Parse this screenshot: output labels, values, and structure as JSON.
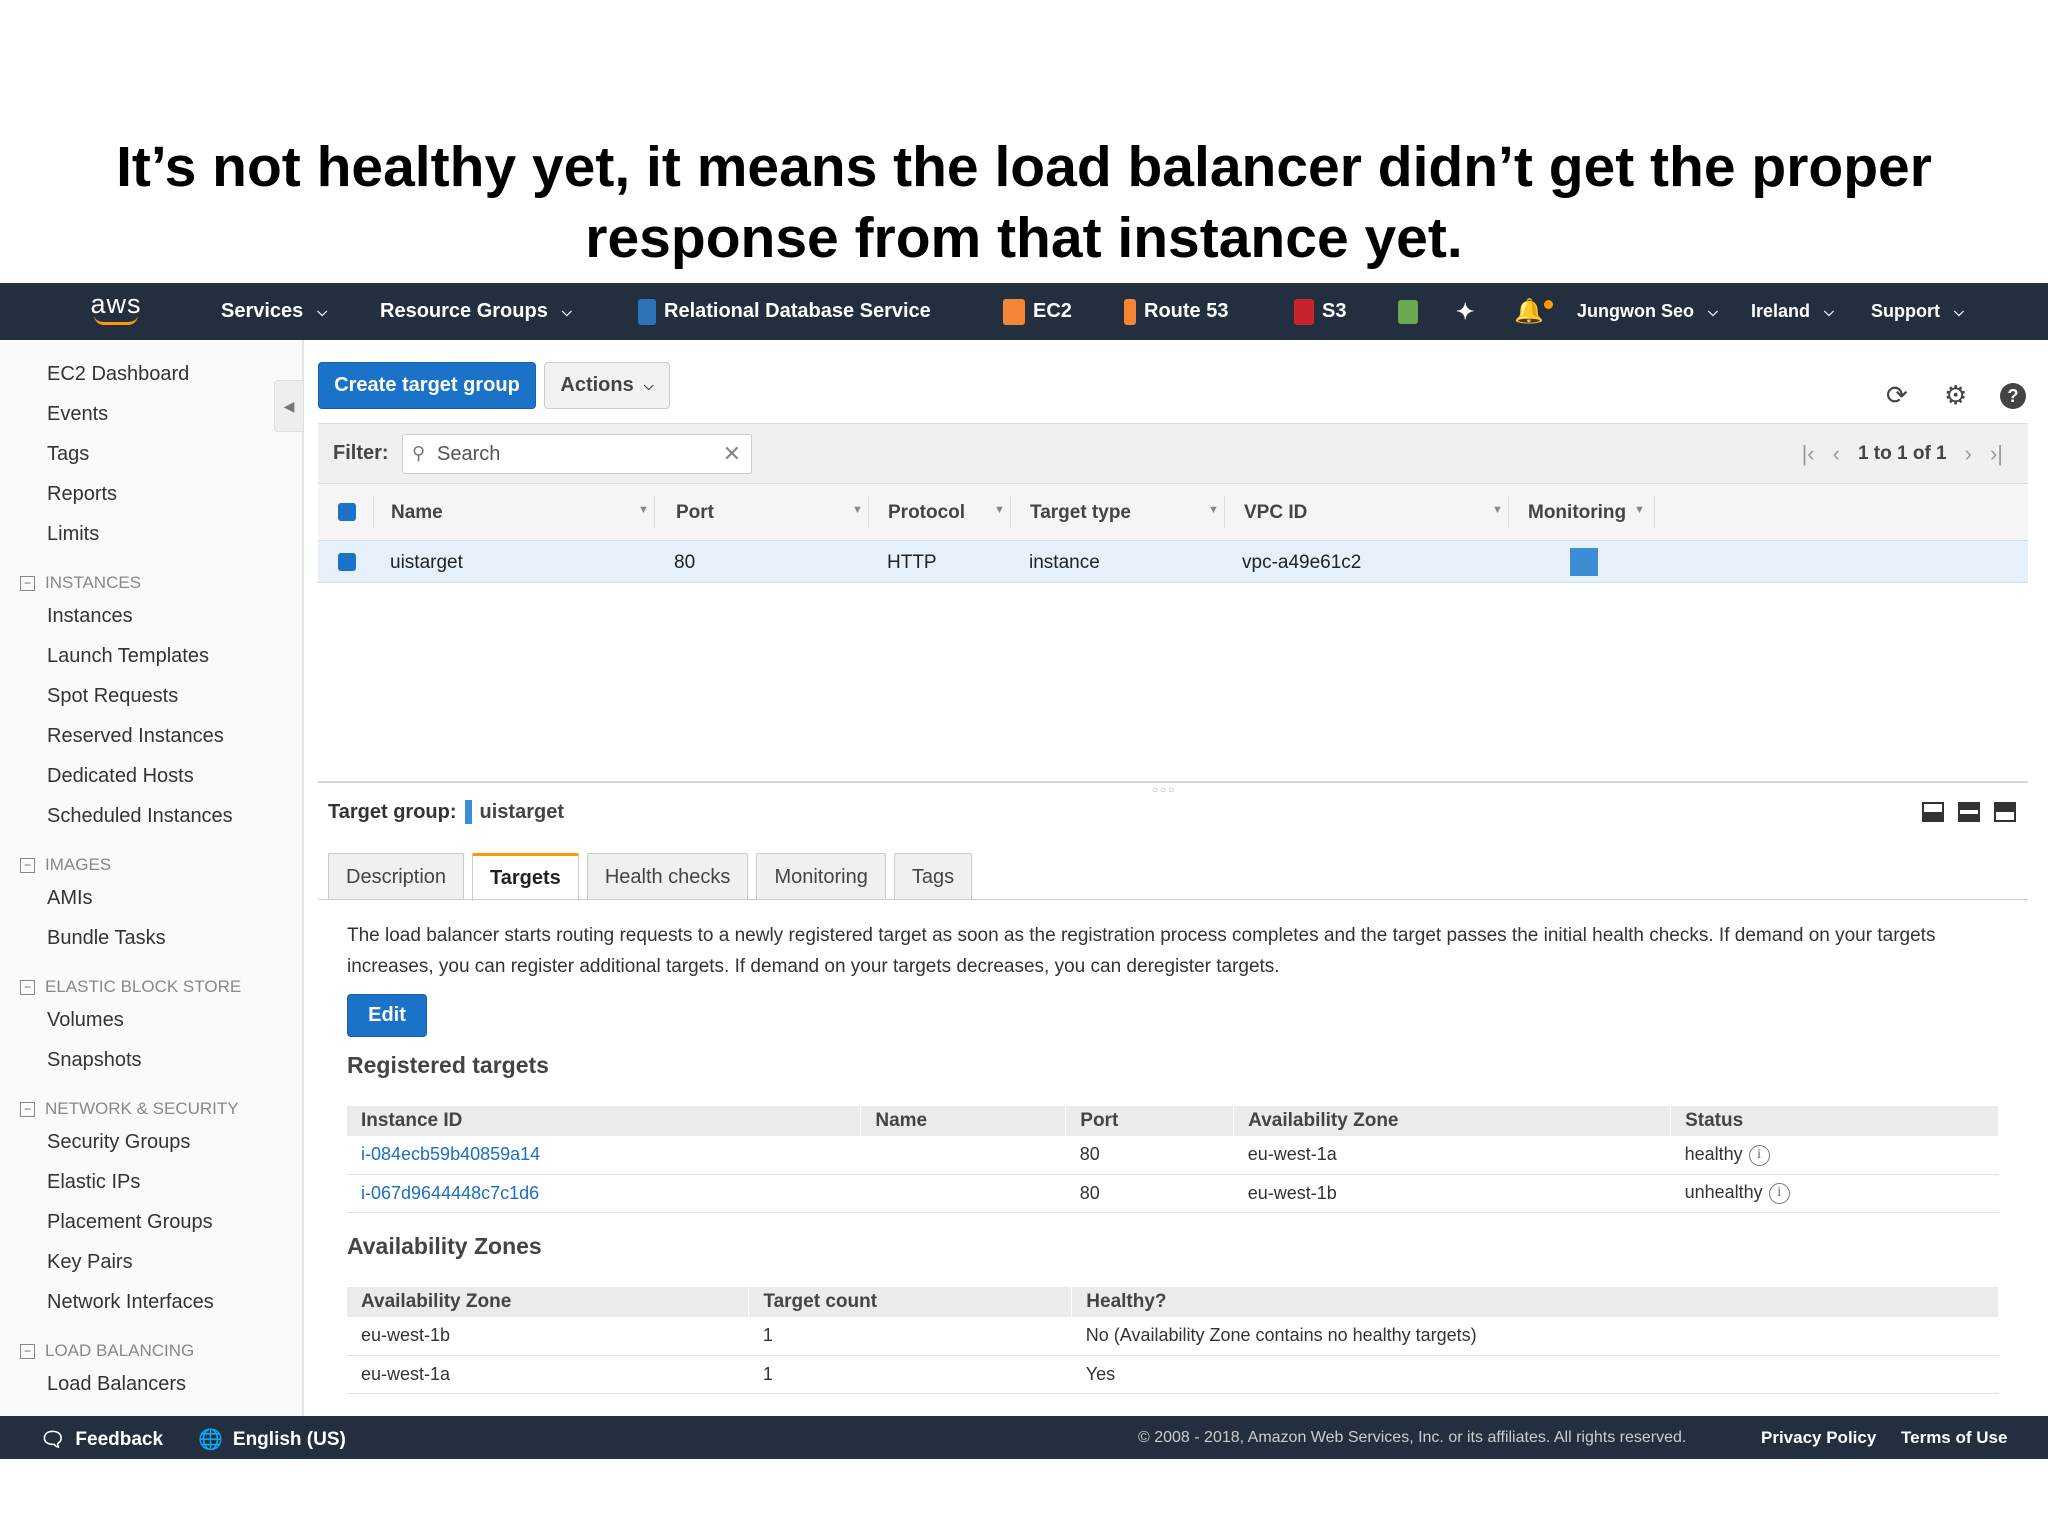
{
  "caption": {
    "line1": "It’s not healthy yet, it means the load balancer didn’t get the proper",
    "line2": "response from that instance yet."
  },
  "topnav": {
    "logo": "aws",
    "services": "Services",
    "resource_groups": "Resource Groups",
    "shortcuts": [
      "Relational Database Service",
      "EC2",
      "Route 53",
      "S3"
    ],
    "user": "Jungwon Seo",
    "region": "Ireland",
    "support": "Support"
  },
  "sidebar": {
    "top_items": [
      "EC2 Dashboard",
      "Events",
      "Tags",
      "Reports",
      "Limits"
    ],
    "sections": [
      {
        "title": "INSTANCES",
        "items": [
          "Instances",
          "Launch Templates",
          "Spot Requests",
          "Reserved Instances",
          "Dedicated Hosts",
          "Scheduled Instances"
        ]
      },
      {
        "title": "IMAGES",
        "items": [
          "AMIs",
          "Bundle Tasks"
        ]
      },
      {
        "title": "ELASTIC BLOCK STORE",
        "items": [
          "Volumes",
          "Snapshots"
        ]
      },
      {
        "title": "NETWORK & SECURITY",
        "items": [
          "Security Groups",
          "Elastic IPs",
          "Placement Groups",
          "Key Pairs",
          "Network Interfaces"
        ]
      },
      {
        "title": "LOAD BALANCING",
        "items": [
          "Load Balancers"
        ]
      }
    ]
  },
  "toolbar": {
    "create_label": "Create target group",
    "actions_label": "Actions"
  },
  "filter": {
    "label": "Filter:",
    "placeholder": "Search",
    "pager": "1 to 1 of 1"
  },
  "grid": {
    "columns": [
      "Name",
      "Port",
      "Protocol",
      "Target type",
      "VPC ID",
      "Monitoring"
    ],
    "rows": [
      {
        "name": "uistarget",
        "port": "80",
        "protocol": "HTTP",
        "target_type": "instance",
        "vpc_id": "vpc-a49e61c2"
      }
    ]
  },
  "detail": {
    "title_label": "Target group:",
    "title_value": "uistarget",
    "tabs": [
      "Description",
      "Targets",
      "Health checks",
      "Monitoring",
      "Tags"
    ],
    "active_tab": "Targets",
    "description": "The load balancer starts routing requests to a newly registered target as soon as the registration process completes and the target passes the initial health checks. If demand on your targets increases, you can register additional targets. If demand on your targets decreases, you can deregister targets.",
    "edit_label": "Edit",
    "registered_title": "Registered targets",
    "registered_columns": [
      "Instance ID",
      "Name",
      "Port",
      "Availability Zone",
      "Status"
    ],
    "registered_rows": [
      {
        "instance_id": "i-084ecb59b40859a14",
        "name": "",
        "port": "80",
        "zone": "eu-west-1a",
        "status": "healthy"
      },
      {
        "instance_id": "i-067d9644448c7c1d6",
        "name": "",
        "port": "80",
        "zone": "eu-west-1b",
        "status": "unhealthy"
      }
    ],
    "az_title": "Availability Zones",
    "az_columns": [
      "Availability Zone",
      "Target count",
      "Healthy?"
    ],
    "az_rows": [
      {
        "zone": "eu-west-1b",
        "count": "1",
        "healthy": "No (Availability Zone contains no healthy targets)"
      },
      {
        "zone": "eu-west-1a",
        "count": "1",
        "healthy": "Yes"
      }
    ]
  },
  "footer": {
    "feedback": "Feedback",
    "language": "English (US)",
    "copyright": "© 2008 - 2018, Amazon Web Services, Inc. or its affiliates. All rights reserved.",
    "privacy": "Privacy Policy",
    "terms": "Terms of Use"
  },
  "colors": {
    "nav_bg": "#232f3e",
    "primary": "#1a73c9",
    "tab_accent": "#ff9900",
    "selected_row": "#e6f1fb"
  }
}
